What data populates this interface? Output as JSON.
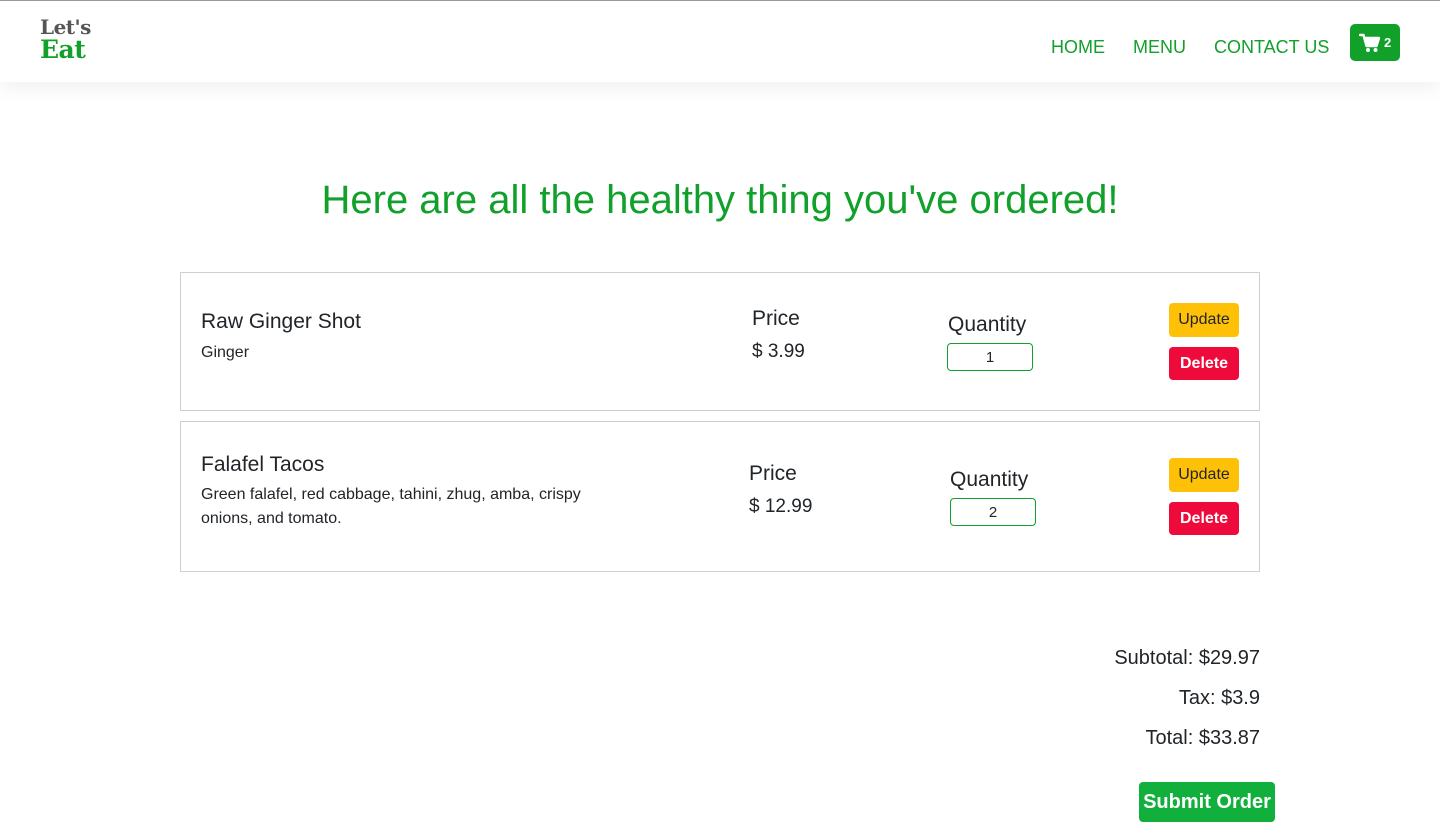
{
  "colors": {
    "brand_green": "#11a02a",
    "update_yellow": "#ffc107",
    "delete_red": "#ee0a3a",
    "submit_green": "#11b03c"
  },
  "header": {
    "logo_line1": "Let's",
    "logo_line2": "Eat",
    "nav": {
      "home": "HOME",
      "menu": "MENU",
      "contact": "CONTACT US"
    },
    "cart": {
      "icon": "cart-icon",
      "count": "2"
    }
  },
  "title": "Here are all the healthy thing you've ordered!",
  "items": [
    {
      "name": "Raw Ginger Shot",
      "description": "Ginger",
      "price_label": "Price",
      "price": "$ 3.99",
      "quantity_label": "Quantity",
      "quantity": "1",
      "update_label": "Update",
      "delete_label": "Delete"
    },
    {
      "name": "Falafel Tacos",
      "description": "Green falafel, red cabbage, tahini, zhug, amba, crispy onions, and tomato.",
      "price_label": "Price",
      "price": "$ 12.99",
      "quantity_label": "Quantity",
      "quantity": "2",
      "update_label": "Update",
      "delete_label": "Delete"
    }
  ],
  "summary": {
    "subtotal": "Subtotal: $29.97",
    "tax": "Tax: $3.9",
    "total": "Total: $33.87"
  },
  "submit_label": "Submit Order"
}
